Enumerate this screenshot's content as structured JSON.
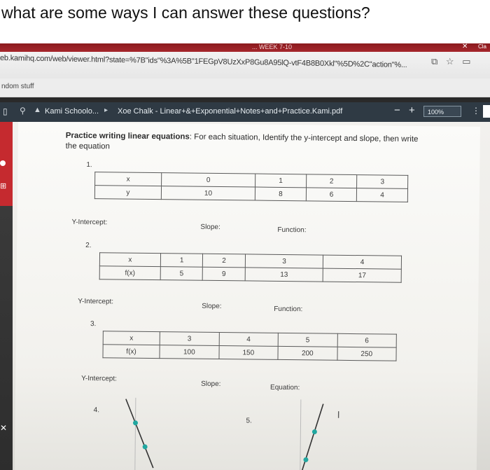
{
  "question": "what are some ways I can answer these questions?",
  "browser": {
    "tab_text": "... WEEK 7-10",
    "url": "eb.kamihq.com/web/viewer.html?state=%7B\"ids\"%3A%5B\"1FEGpV8UzXxP8Gu8A95lQ-vtF4B8B0Xkl\"%5D%2C\"action\"%...",
    "bookmark": "ndom stuff"
  },
  "kami": {
    "breadcrumb_1": "Kami Schoolo...",
    "breadcrumb_2": "Xoe Chalk - Linear+&+Exponential+Notes+and+Practice.Kami.pdf",
    "zoom_minus": "−",
    "zoom_plus": "+",
    "zoom": "100%"
  },
  "worksheet": {
    "title_bold": "Practice writing linear equations",
    "title_rest": ": For each situation, Identify the y-intercept and slope, then write the equation",
    "problems": [
      {
        "number": "1.",
        "row1_label": "x",
        "row1": [
          "0",
          "1",
          "2",
          "3"
        ],
        "row2_label": "y",
        "row2": [
          "10",
          "8",
          "6",
          "4"
        ],
        "intercept_label": "Y-Intercept:",
        "slope_label": "Slope:",
        "third_label": "Function:"
      },
      {
        "number": "2.",
        "row1_label": "x",
        "row1": [
          "1",
          "2",
          "3",
          "4"
        ],
        "row2_label": "f(x)",
        "row2": [
          "5",
          "9",
          "13",
          "17"
        ],
        "intercept_label": "Y-Intercept:",
        "slope_label": "Slope:",
        "third_label": "Function:"
      },
      {
        "number": "3.",
        "row1_label": "x",
        "row1": [
          "3",
          "4",
          "5",
          "6"
        ],
        "row2_label": "f(x)",
        "row2": [
          "100",
          "150",
          "200",
          "250"
        ],
        "intercept_label": "Y-Intercept:",
        "slope_label": "Slope:",
        "third_label": "Equation:"
      }
    ],
    "problem4_number": "4.",
    "problem5_number": "5."
  }
}
